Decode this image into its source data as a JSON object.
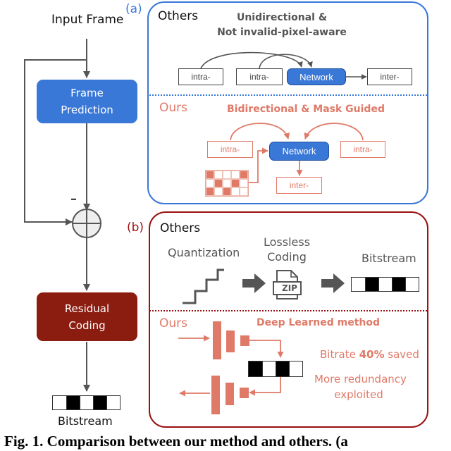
{
  "colors": {
    "blue": "#3a78d8",
    "dark_red": "#8b1d10",
    "salmon": "#e07a68",
    "gray": "#555555",
    "panel_b_border": "#9b1010"
  },
  "pipeline": {
    "input_label": "Input Frame",
    "frame_prediction_label_1": "Frame",
    "frame_prediction_label_2": "Prediction",
    "minus_sign": "–",
    "adder_icon": "plus-circle-icon",
    "residual_coding_label_1": "Residual",
    "residual_coding_label_2": "Coding",
    "bitstream_label": "Bitstream",
    "bitstream_bits": [
      0,
      1,
      0,
      1,
      0
    ]
  },
  "panel_a": {
    "tag": "(a)",
    "others": {
      "label": "Others",
      "title_line_1": "Unidirectional &",
      "title_line_2": "Not invalid-pixel-aware",
      "boxes": [
        "intra-",
        "intra-",
        "Network",
        "inter-"
      ]
    },
    "ours": {
      "label": "Ours",
      "title": "Bidirectional & Mask Guided",
      "left_box": "intra-",
      "network": "Network",
      "right_box": "intra-",
      "output_box": "inter-",
      "mask_grid": [
        [
          1,
          0,
          0,
          0,
          1
        ],
        [
          0,
          1,
          0,
          1,
          0
        ],
        [
          1,
          0,
          1,
          0,
          0
        ]
      ]
    }
  },
  "panel_b": {
    "tag": "(b)",
    "others": {
      "label": "Others",
      "quantization_label": "Quantization",
      "lossless_label_1": "Lossless",
      "lossless_label_2": "Coding",
      "zip_text": "ZIP",
      "bitstream_label": "Bitstream",
      "bitstream_bits": [
        0,
        1,
        0,
        1,
        0
      ]
    },
    "ours": {
      "label": "Ours",
      "title": "Deep Learned method",
      "bitrate_prefix": "Bitrate ",
      "bitrate_value": "40%",
      "bitrate_suffix": " saved",
      "redundancy_line_1": "More redundancy",
      "redundancy_line_2": "exploited",
      "latent_bits": [
        1,
        0,
        1,
        0
      ]
    }
  },
  "caption": "Fig. 1.  Comparison between our method and others. (a"
}
